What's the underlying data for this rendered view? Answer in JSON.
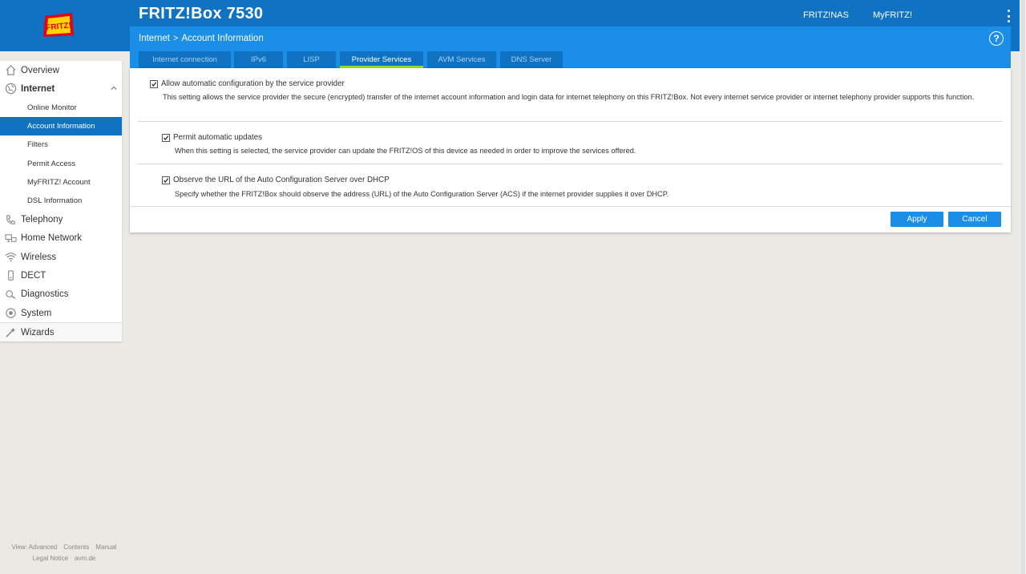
{
  "header": {
    "product_name": "FRITZ!Box 7530",
    "links": {
      "fritznas": "FRITZ!NAS",
      "myfritz": "MyFRITZ!"
    },
    "logo_text": "FRITZ!"
  },
  "sidebar": {
    "items": [
      {
        "label": "Overview",
        "icon": "home-icon"
      },
      {
        "label": "Internet",
        "icon": "globe-icon",
        "expanded": true,
        "sub": [
          "Online Monitor",
          "Account Information",
          "Filters",
          "Permit Access",
          "MyFRITZ! Account",
          "DSL Information"
        ],
        "active_sub": "Account Information"
      },
      {
        "label": "Telephony",
        "icon": "phone-icon"
      },
      {
        "label": "Home Network",
        "icon": "network-icon"
      },
      {
        "label": "Wireless",
        "icon": "wireless-icon"
      },
      {
        "label": "DECT",
        "icon": "dect-icon"
      },
      {
        "label": "Diagnostics",
        "icon": "diagnostics-icon"
      },
      {
        "label": "System",
        "icon": "system-icon"
      },
      {
        "label": "Wizards",
        "icon": "wizards-icon"
      }
    ]
  },
  "breadcrumb": {
    "section": "Internet",
    "separator": ">",
    "page": "Account Information"
  },
  "tabs": [
    "Internet connection",
    "IPv6",
    "LISP",
    "Provider Services",
    "AVM Services",
    "DNS Server"
  ],
  "active_tab": "Provider Services",
  "settings": [
    {
      "checked": true,
      "title": "Allow automatic configuration by the service provider",
      "description": "This setting allows the service provider the secure (encrypted) transfer of the internet account information and login data for internet telephony on this FRITZ!Box. Not every internet service provider or internet telephony provider supports this function."
    },
    {
      "checked": true,
      "title": "Permit automatic updates",
      "description": "When this setting is selected, the service provider can update the FRITZ!OS of this device as needed in order to improve the services offered."
    },
    {
      "checked": true,
      "title": "Observe the URL of the Auto Configuration Server over DHCP",
      "description": "Specify whether the FRITZ!Box should observe the address (URL) of the Auto Configuration Server (ACS) if the internet provider supplies it over DHCP."
    }
  ],
  "buttons": {
    "apply": "Apply",
    "cancel": "Cancel"
  },
  "footer": {
    "view": "View: Advanced",
    "contents": "Contents",
    "manual": "Manual",
    "legal": "Legal Notice",
    "site": "avm.de"
  },
  "colors": {
    "brand_blue": "#0f72c2",
    "header_blue": "#1b8ee8",
    "tab_active_underline": "#9cd62a",
    "background": "#ebe9e4"
  }
}
